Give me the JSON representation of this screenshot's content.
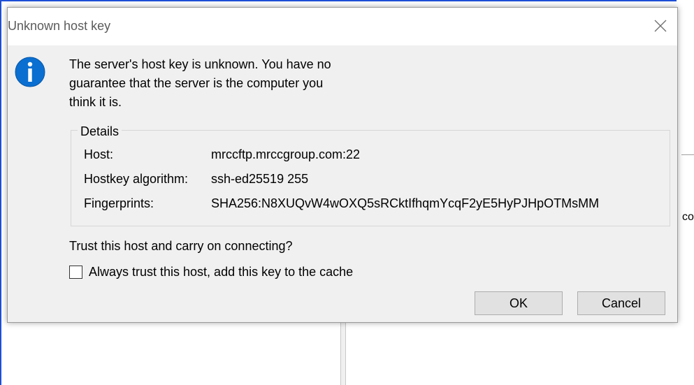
{
  "dialog": {
    "title": "Unknown host key",
    "message_lines": [
      "The server's host key is unknown. You have no",
      "guarantee that the server is the computer you",
      "think it is."
    ],
    "details": {
      "legend": "Details",
      "rows": [
        {
          "label": "Host:",
          "value": "mrccftp.mrccgroup.com:22"
        },
        {
          "label": "Hostkey algorithm:",
          "value": "ssh-ed25519 255"
        },
        {
          "label": "Fingerprints:",
          "value": "SHA256:N8XUQvW4wOXQ5sRCktIfhqmYcqF2yE5HyPJHpOTMsMM"
        }
      ]
    },
    "question": "Trust this host and carry on connecting?",
    "checkbox_label": "Always trust this host, add this key to the cache",
    "checkbox_checked": false,
    "ok_label": "OK",
    "cancel_label": "Cancel"
  },
  "background": {
    "partial_text": "co"
  },
  "colors": {
    "info_icon": "#0a6fd1",
    "window_border": "#1f4fd6",
    "dialog_bg": "#f0f0f0"
  },
  "icons": {
    "info": "info-icon",
    "close": "close-icon"
  }
}
